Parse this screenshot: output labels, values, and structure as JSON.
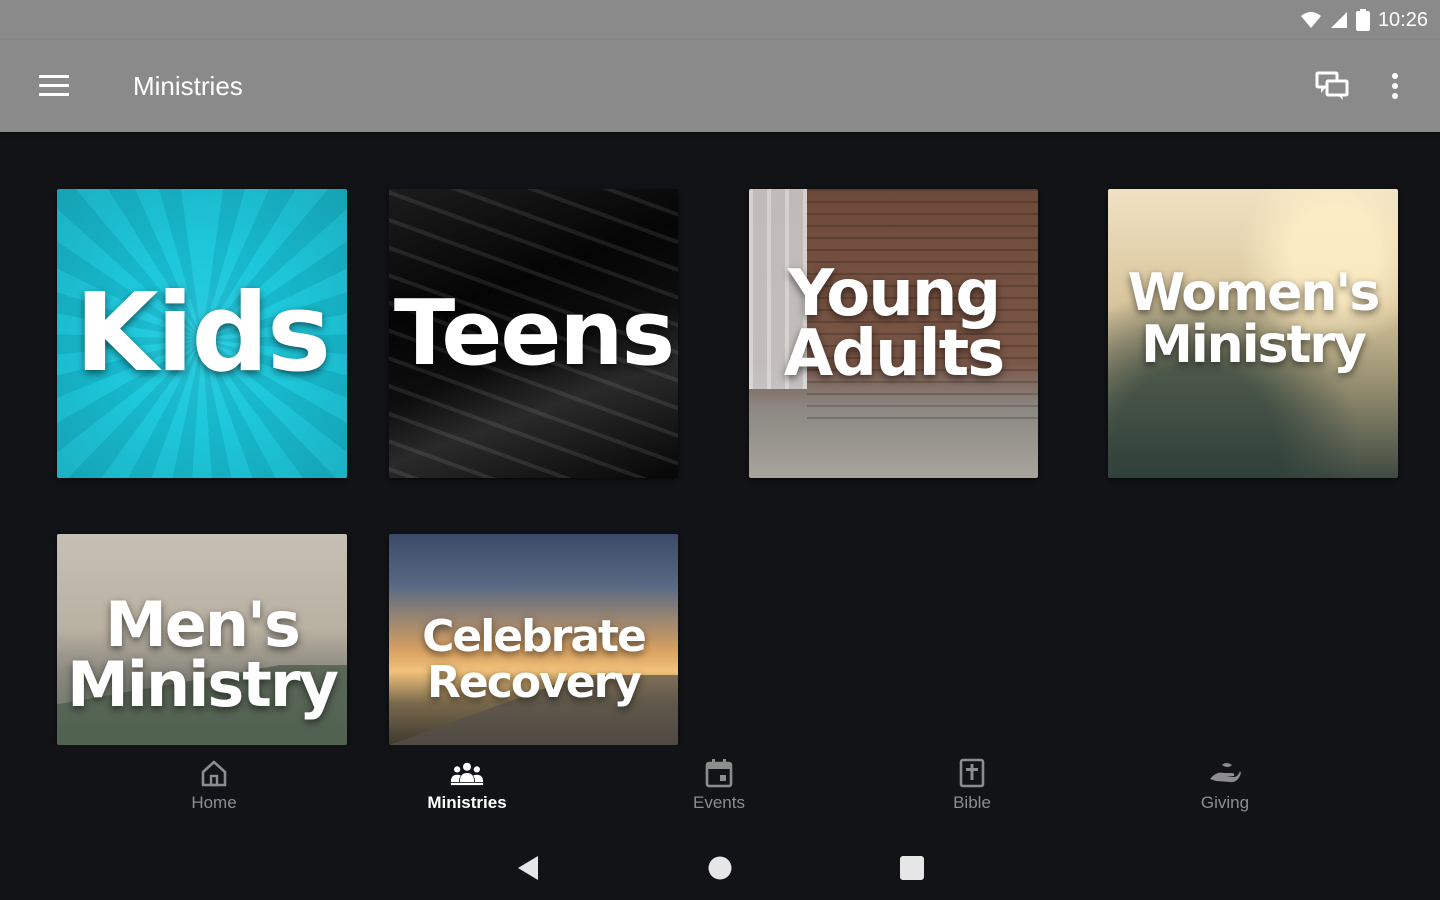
{
  "status_bar": {
    "time": "10:26"
  },
  "app_bar": {
    "title": "Ministries"
  },
  "tiles": [
    {
      "id": "kids",
      "label": "Kids"
    },
    {
      "id": "teens",
      "label": "Teens"
    },
    {
      "id": "young_adults",
      "label_line1": "Young",
      "label_line2": "Adults"
    },
    {
      "id": "womens",
      "label_line1": "Women's",
      "label_line2": "Ministry"
    },
    {
      "id": "mens",
      "label_line1": "Men's",
      "label_line2": "Ministry"
    },
    {
      "id": "celebrate",
      "label_line1": "Celebrate",
      "label_line2": "Recovery"
    }
  ],
  "bottom_nav": {
    "items": [
      {
        "label": "Home",
        "icon": "home-icon",
        "active": false
      },
      {
        "label": "Ministries",
        "icon": "people-icon",
        "active": true
      },
      {
        "label": "Events",
        "icon": "calendar-icon",
        "active": false
      },
      {
        "label": "Bible",
        "icon": "bible-icon",
        "active": false
      },
      {
        "label": "Giving",
        "icon": "giving-icon",
        "active": false
      }
    ]
  },
  "colors": {
    "app_bar": "#8a8a8a",
    "background": "#121316",
    "active_nav": "#ffffff",
    "inactive_nav": "#8d8d8d"
  }
}
